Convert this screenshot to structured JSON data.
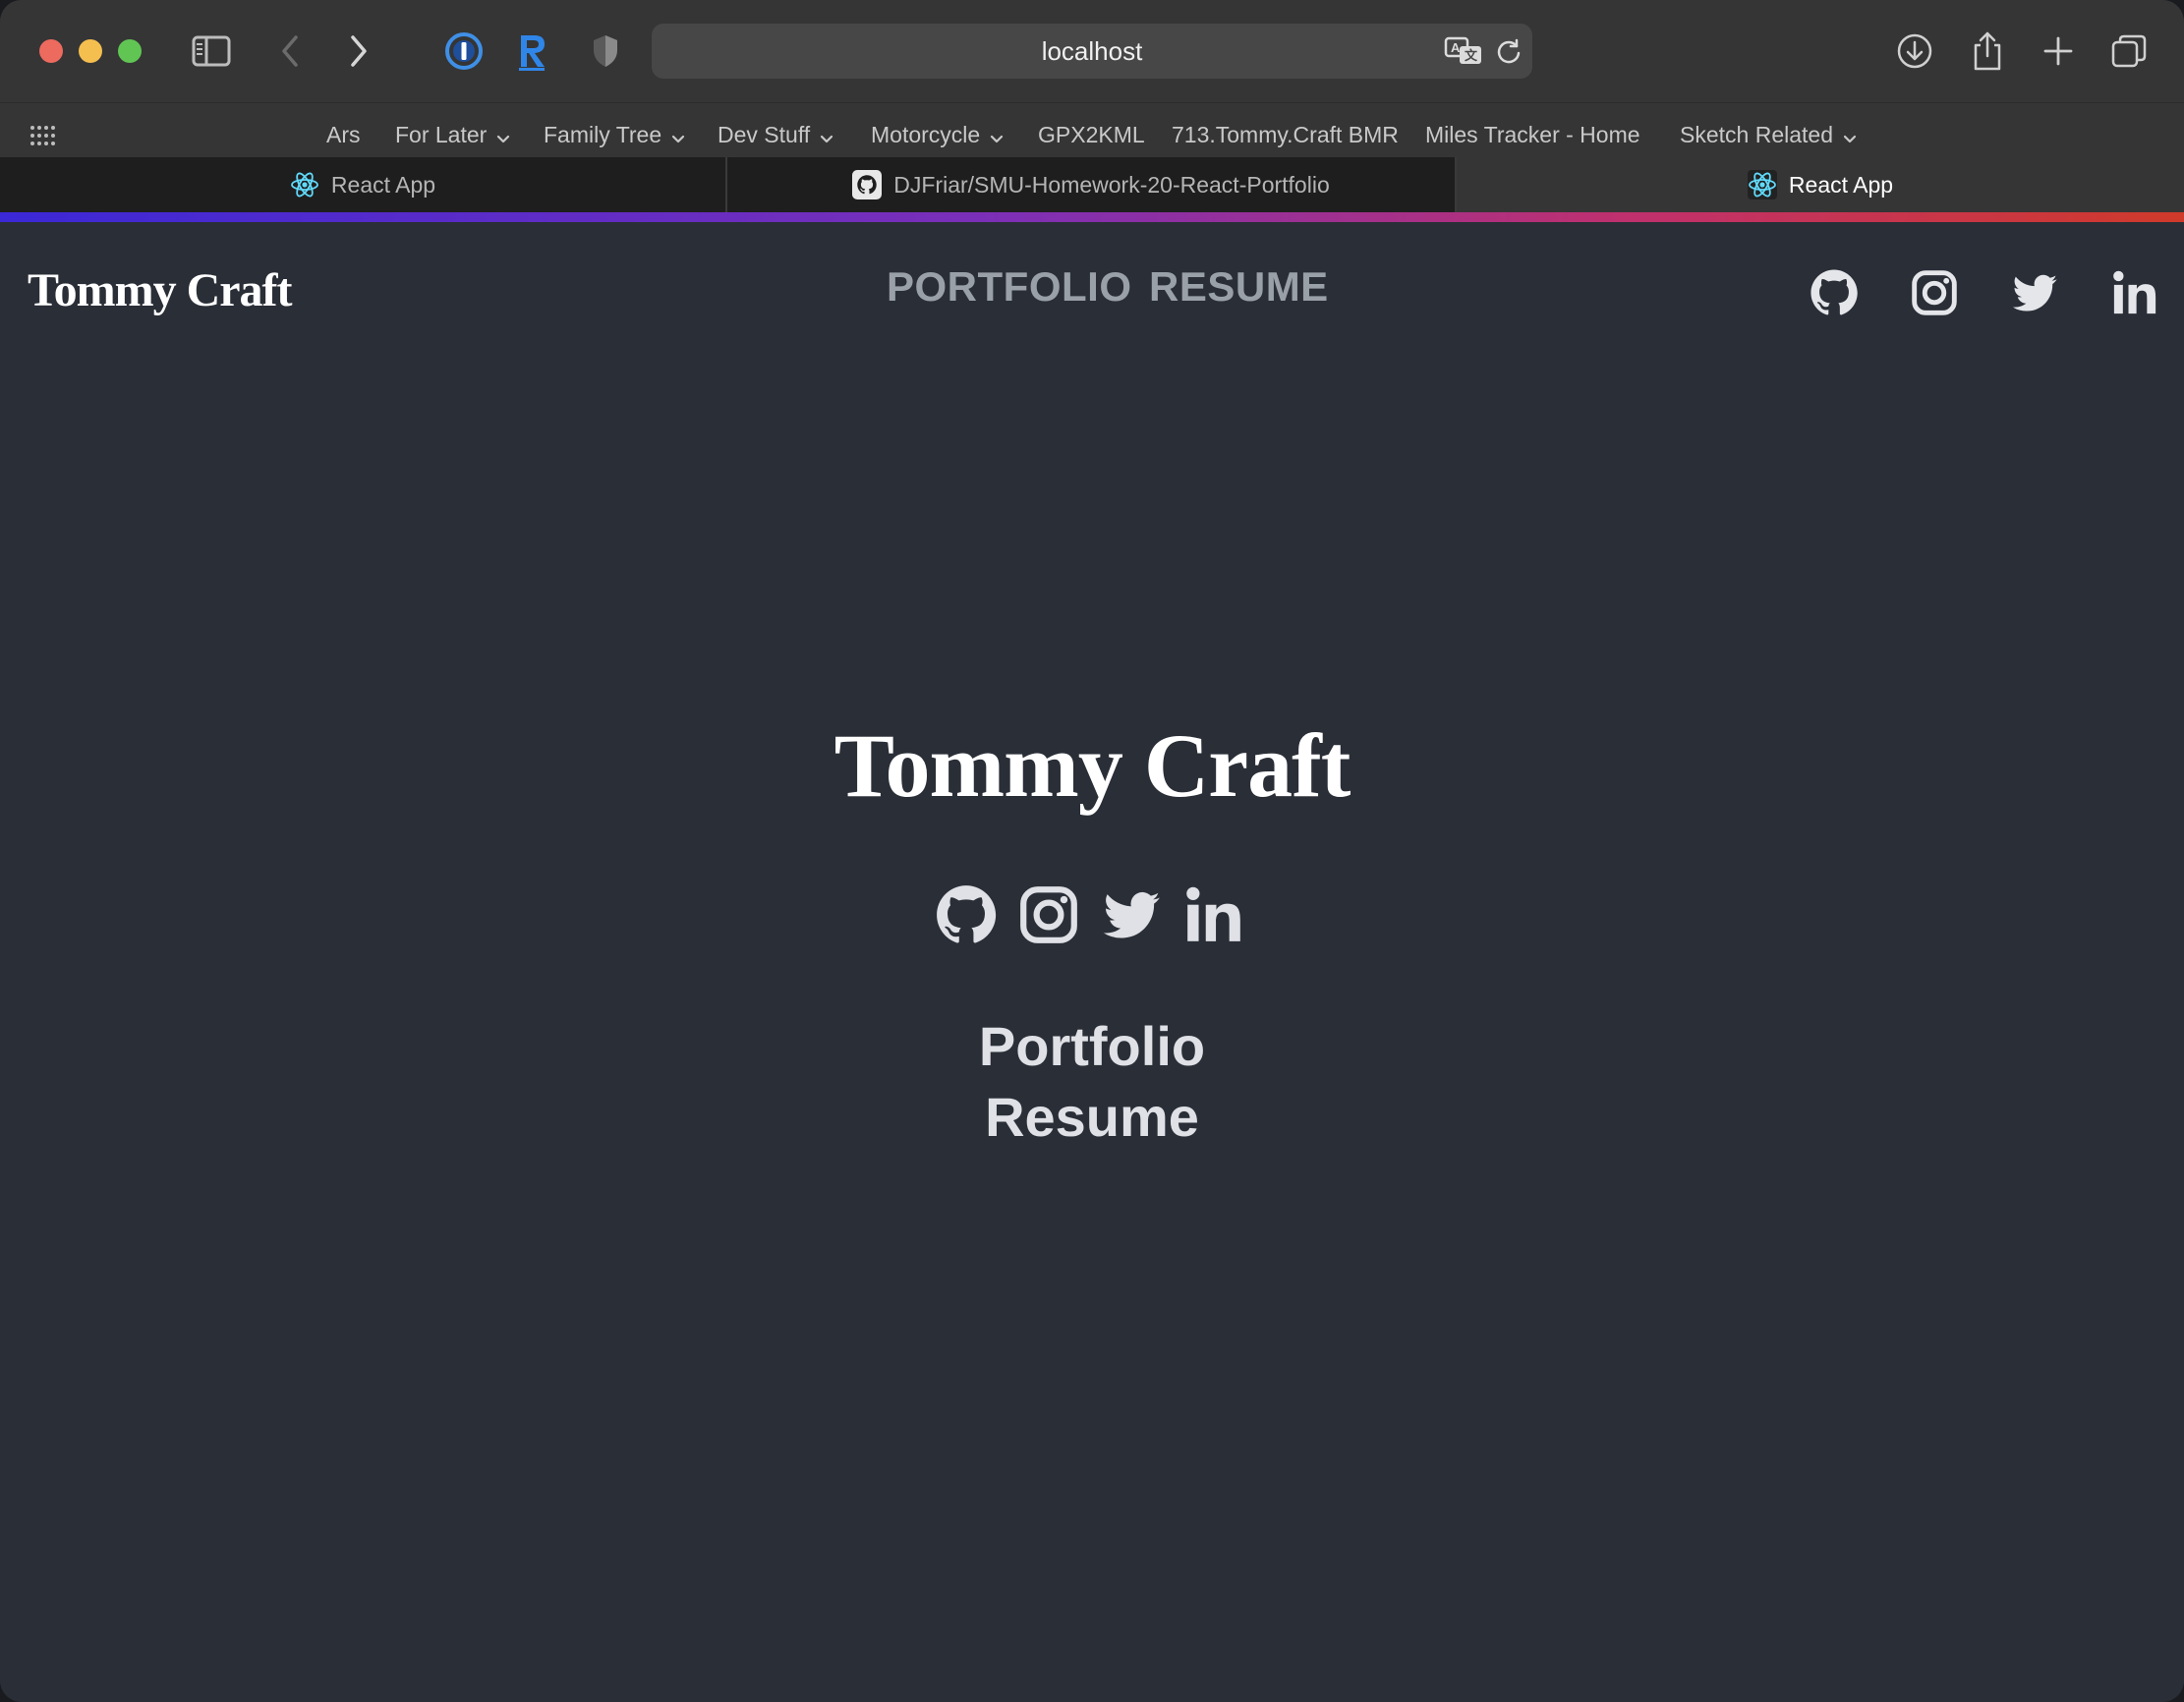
{
  "browser": {
    "url": "localhost",
    "bookmarks": [
      "Ars",
      "For Later",
      "Family Tree",
      "Dev Stuff",
      "Motorcycle",
      "GPX2KML",
      "713.Tommy.Craft BMR",
      "Miles Tracker - Home",
      "Sketch Related"
    ],
    "tabs": [
      {
        "label": "React App",
        "icon": "react-icon"
      },
      {
        "label": "DJFriar/SMU-Homework-20-React-Portfolio",
        "icon": "github-icon"
      },
      {
        "label": "React App",
        "icon": "react-icon"
      }
    ]
  },
  "header": {
    "brand": "Tommy Craft",
    "nav": [
      "PORTFOLIO",
      "RESUME"
    ],
    "social": [
      "github-icon",
      "instagram-icon",
      "twitter-icon",
      "linkedin-icon"
    ]
  },
  "hero": {
    "title": "Tommy Craft",
    "links": [
      "Portfolio",
      "Resume"
    ]
  },
  "colors": {
    "page_bg": "#2a2e37",
    "chrome_bg": "#353535",
    "accent_gradient_start": "#3b28d6",
    "accent_gradient_end": "#d03a2a"
  }
}
